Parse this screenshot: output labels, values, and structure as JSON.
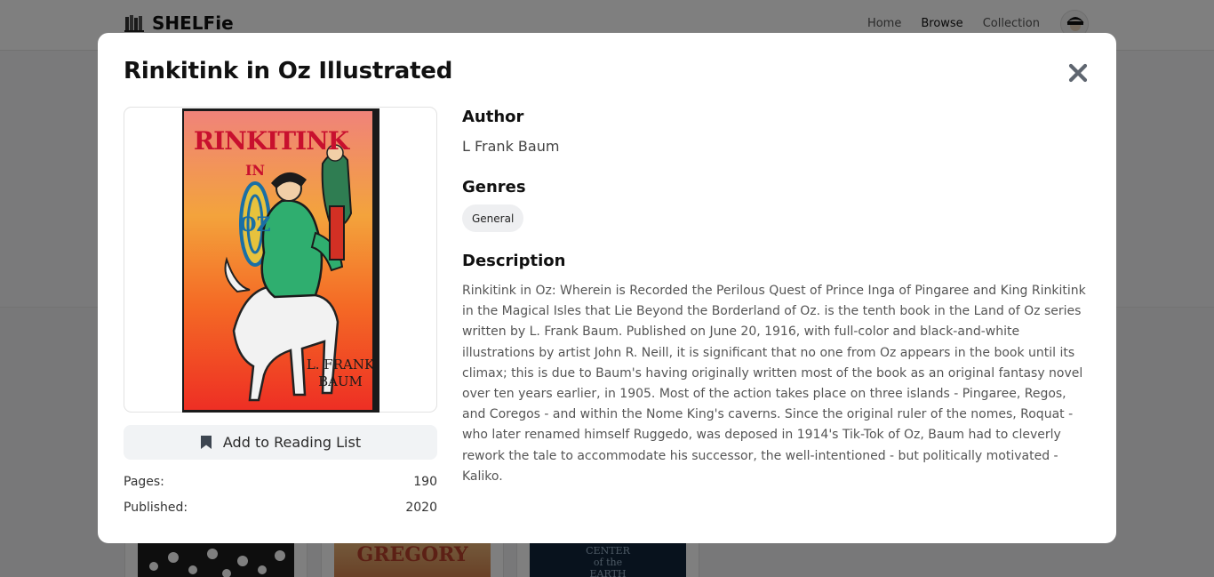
{
  "app": {
    "name": "SHELFie",
    "brand_icon": "books-icon"
  },
  "nav": {
    "links": [
      {
        "label": "Home",
        "active": false
      },
      {
        "label": "Browse",
        "active": true
      },
      {
        "label": "Collection",
        "active": false
      }
    ]
  },
  "background_books": [
    {
      "cover_text": "",
      "colors": [
        "#1c1c1c",
        "#ffffff"
      ]
    },
    {
      "cover_text": "GREGORY",
      "colors": [
        "#e0a35f",
        "#b8402a"
      ]
    },
    {
      "cover_text": "CENTER of the EARTH",
      "colors": [
        "#10243b",
        "#9ab3c9"
      ]
    }
  ],
  "modal": {
    "title": "Rinkitink in Oz Illustrated",
    "close_icon": "close-icon",
    "cover": {
      "title_lines": [
        "RINKITINK",
        "IN",
        "OZ"
      ],
      "author_lines": [
        "L. FRANK",
        "BAUM"
      ],
      "gradient": [
        "#f0837a",
        "#f3a33c",
        "#f46a25",
        "#ee2f24"
      ]
    },
    "reading_list": {
      "label": "Add to Reading List",
      "icon": "bookmark-icon"
    },
    "meta": [
      {
        "label": "Pages:",
        "value": "190"
      },
      {
        "label": "Published:",
        "value": "2020"
      }
    ],
    "author": {
      "heading": "Author",
      "value": "L Frank Baum"
    },
    "genres": {
      "heading": "Genres",
      "items": [
        "General"
      ]
    },
    "description": {
      "heading": "Description",
      "text": "Rinkitink in Oz: Wherein is Recorded the Perilous Quest of Prince Inga of Pingaree and King Rinkitink in the Magical Isles that Lie Beyond the Borderland of Oz. is the tenth book in the Land of Oz series written by L. Frank Baum. Published on June 20, 1916, with full-color and black-and-white illustrations by artist John R. Neill, it is significant that no one from Oz appears in the book until its climax; this is due to Baum's having originally written most of the book as an original fantasy novel over ten years earlier, in 1905. Most of the action takes place on three islands - Pingaree, Regos, and Coregos - and within the Nome King's caverns. Since the original ruler of the nomes, Roquat - who later renamed himself Ruggedo, was deposed in 1914's Tik-Tok of Oz, Baum had to cleverly rework the tale to accommodate his successor, the well-intentioned - but politically motivated - Kaliko."
    }
  }
}
